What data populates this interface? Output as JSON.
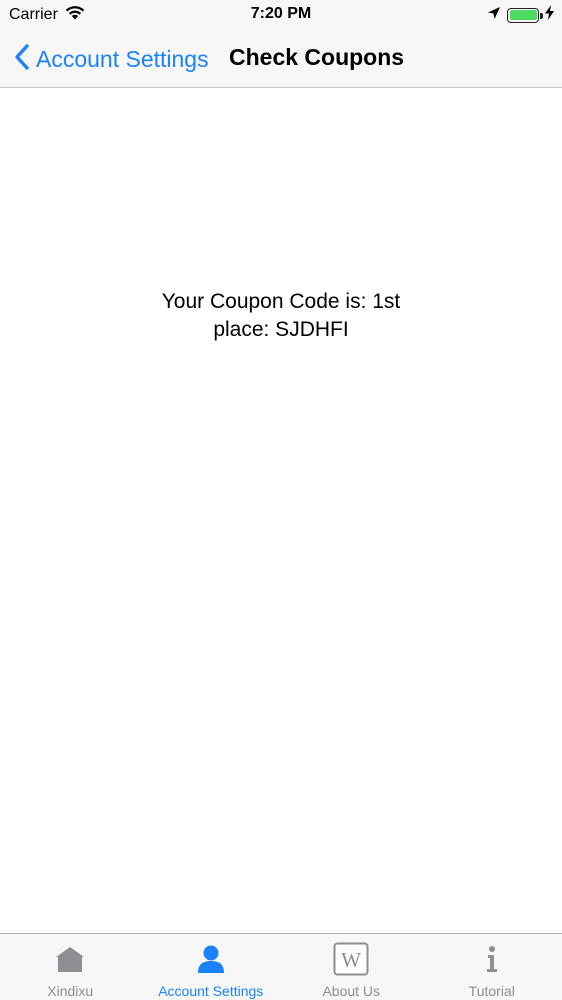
{
  "status_bar": {
    "carrier": "Carrier",
    "time": "7:20 PM",
    "battery_level": 1.0
  },
  "nav": {
    "back_label": "Account Settings",
    "title": "Check Coupons"
  },
  "content": {
    "coupon_text": "Your Coupon Code is: 1st place: SJDHFI"
  },
  "tab_bar": {
    "items": [
      {
        "label": "Xindixu",
        "icon": "home-icon",
        "active": false
      },
      {
        "label": "Account Settings",
        "icon": "person-icon",
        "active": true
      },
      {
        "label": "About Us",
        "icon": "wikipedia-icon",
        "active": false
      },
      {
        "label": "Tutorial",
        "icon": "info-icon",
        "active": false
      }
    ]
  },
  "colors": {
    "accent": "#1a82fb",
    "inactive": "#8e8e93",
    "battery": "#4cd964",
    "bar_background": "#f7f7f7"
  }
}
